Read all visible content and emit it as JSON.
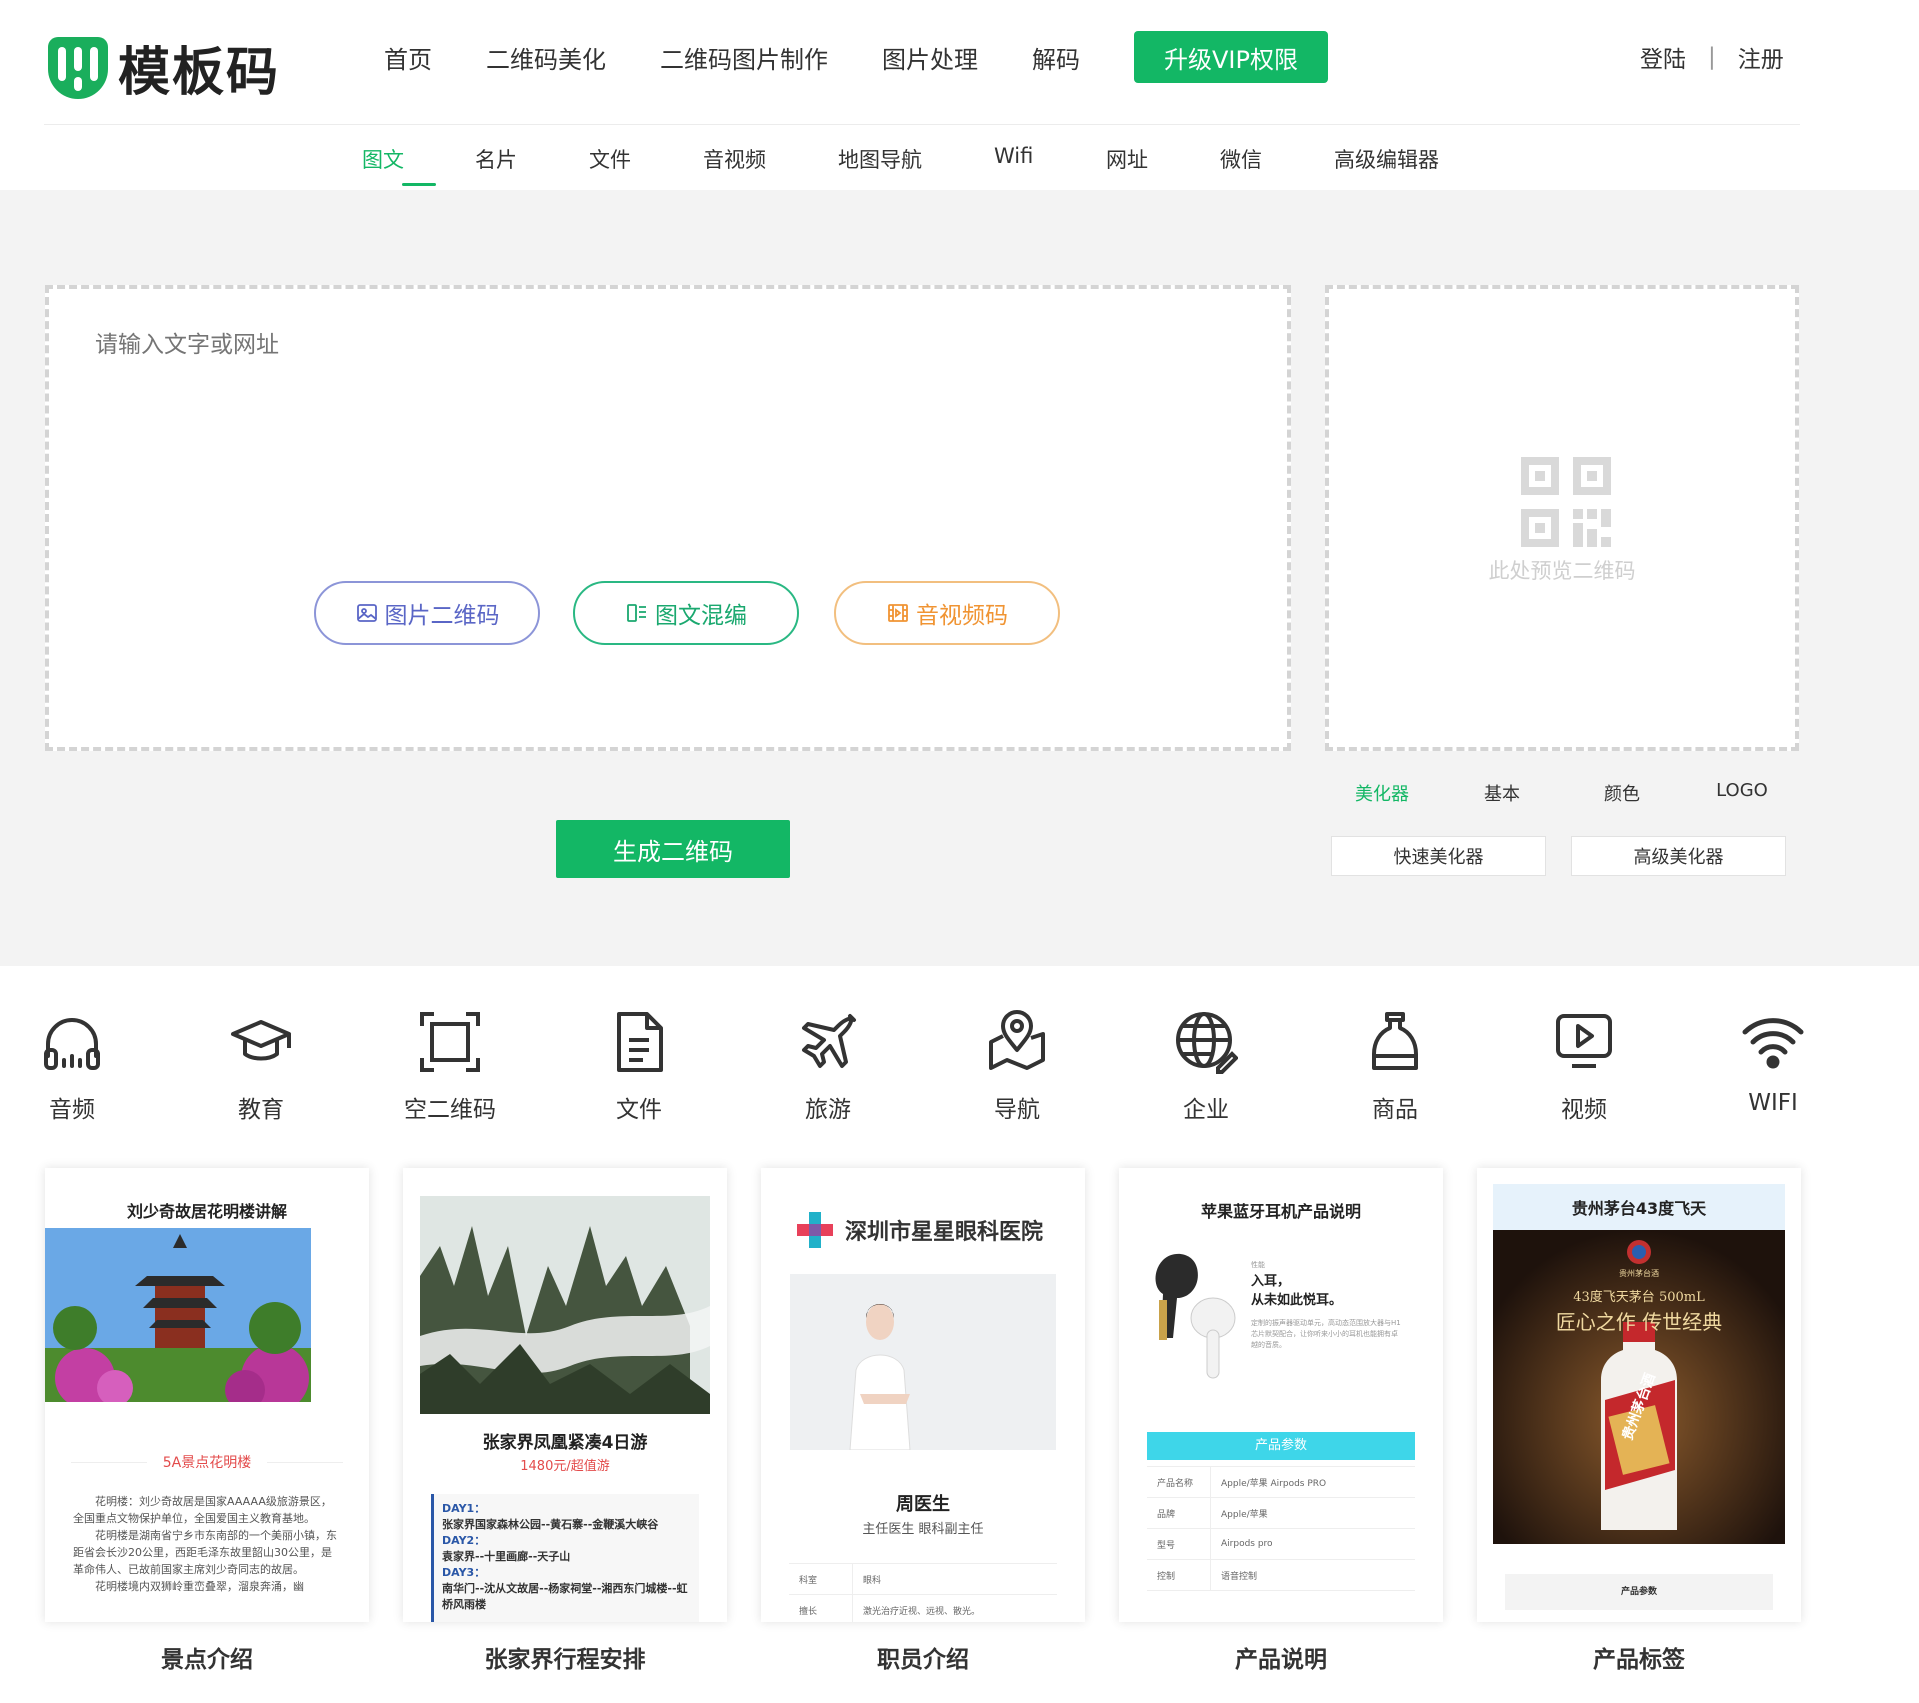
{
  "header": {
    "logo_text": "模板码",
    "nav": [
      "首页",
      "二维码美化",
      "二维码图片制作",
      "图片处理",
      "解码"
    ],
    "vip_label": "升级VIP权限",
    "login": "登陆",
    "separator": "|",
    "register": "注册"
  },
  "subnav": [
    "图文",
    "名片",
    "文件",
    "音视频",
    "地图导航",
    "Wifi",
    "网址",
    "微信",
    "高级编辑器"
  ],
  "editor": {
    "placeholder": "请输入文字或网址",
    "btn_image": "图片二维码",
    "btn_mixed": "图文混编",
    "btn_av": "音视频码",
    "generate": "生成二维码"
  },
  "preview": {
    "placeholder": "此处预览二维码",
    "tabs": [
      "美化器",
      "基本",
      "颜色",
      "LOGO"
    ],
    "btn_quick": "快速美化器",
    "btn_advanced": "高级美化器"
  },
  "categories": [
    {
      "label": "音频",
      "icon": "headphones-icon"
    },
    {
      "label": "教育",
      "icon": "graduation-cap-icon"
    },
    {
      "label": "空二维码",
      "icon": "scan-frame-icon"
    },
    {
      "label": "文件",
      "icon": "document-icon"
    },
    {
      "label": "旅游",
      "icon": "airplane-icon"
    },
    {
      "label": "导航",
      "icon": "map-pin-icon"
    },
    {
      "label": "企业",
      "icon": "globe-icon"
    },
    {
      "label": "商品",
      "icon": "bottle-icon"
    },
    {
      "label": "视频",
      "icon": "video-icon"
    },
    {
      "label": "WIFI",
      "icon": "wifi-icon"
    }
  ],
  "cards": [
    {
      "caption": "景点介绍",
      "title": "刘少奇故居花明楼讲解",
      "subtitle": "5A景点花明楼",
      "body1": "花明楼：刘少奇故居是国家AAAAA级旅游景区，全国重点文物保护单位，全国爱国主义教育基地。",
      "body2": "花明楼是湖南省宁乡市东南部的一个美丽小镇，东距省会长沙20公里，西距毛泽东故里韶山30公里，是革命伟人、已故前国家主席刘少奇同志的故居。",
      "body3": "花明楼境内双狮岭重峦叠翠，溜泉奔涌，幽"
    },
    {
      "caption": "张家界行程安排",
      "title": "张家界凤凰紧凑4日游",
      "price": "1480元/超值游",
      "day1": "DAY1：",
      "day1_text": "张家界国家森林公园--黄石寨--金鞭溪大峡谷",
      "day2": "DAY2：",
      "day2_text": "袁家界--十里画廊--天子山",
      "day3": "DAY3：",
      "day3_text": "南华门--沈从文故居--杨家祠堂--湘西东门城楼--虹桥风雨楼"
    },
    {
      "caption": "职员介绍",
      "hospital": "深圳市星星眼科医院",
      "name": "周医生",
      "role": "主任医生 眼科副主任",
      "rows": [
        [
          "科室",
          "眼科"
        ],
        [
          "擅长",
          "激光治疗近视、远视、散光。"
        ]
      ]
    },
    {
      "caption": "产品说明",
      "title": "苹果蓝牙耳机产品说明",
      "tiny": "性能",
      "tag1": "入耳，",
      "tag2": "从未如此悦耳。",
      "desc": "定制的振声器驱动单元，高动态范围放大器与H1芯片默契配合，让你听来小小的耳机也能拥有卓越的音质。",
      "param_header": "产品参数",
      "rows": [
        [
          "产品名称",
          "Apple/苹果 Airpods PRO"
        ],
        [
          "品牌",
          "Apple/苹果"
        ],
        [
          "型号",
          "Airpods pro"
        ],
        [
          "控制",
          "语音控制"
        ]
      ]
    },
    {
      "caption": "产品标签",
      "title": "贵州茅台43度飞天",
      "brand": "贵州茅台酒",
      "line1": "43度飞天茅台 500mL",
      "line2": "匠心之作 传世经典",
      "param": "产品参数",
      "bottle_label": "贵州茅台酒"
    }
  ],
  "colors": {
    "accent": "#13b765",
    "blue": "#5a66c6",
    "orange": "#f09433"
  }
}
